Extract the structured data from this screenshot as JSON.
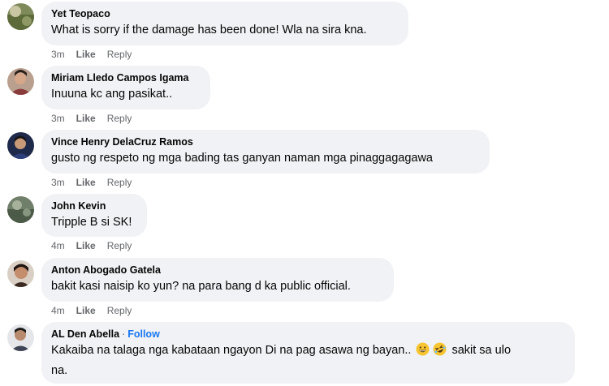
{
  "comments": [
    {
      "author": "Yet Teopaco",
      "text": "What is sorry if the damage has been done! Wla na sira kna.",
      "time": "3m",
      "like": "Like",
      "reply": "Reply"
    },
    {
      "author": "Miriam Lledo Campos Igama",
      "text": "Inuuna kc ang pasikat..",
      "time": "3m",
      "like": "Like",
      "reply": "Reply"
    },
    {
      "author": "Vince Henry DelaCruz Ramos",
      "text": "gusto ng respeto ng mga bading tas ganyan naman mga pinaggagagawa",
      "time": "3m",
      "like": "Like",
      "reply": "Reply"
    },
    {
      "author": "John Kevin",
      "text": "Tripple B si SK!",
      "time": "4m",
      "like": "Like",
      "reply": "Reply"
    },
    {
      "author": "Anton Abogado Gatela",
      "text": "bakit kasi naisip ko yun? na para bang d ka public official.",
      "time": "4m",
      "like": "Like",
      "reply": "Reply"
    },
    {
      "author": "AL Den Abella",
      "separator": "·",
      "follow": "Follow",
      "text_line1": "Kakaiba na talaga nga kabataan ngayon Di na pag asawa ng bayan..",
      "emoji1": "grinning-face-icon",
      "emoji2": "rolling-on-floor-laughing-icon",
      "text_line1_end": "sakit sa ulo",
      "text_line2": "na."
    }
  ],
  "colors": {
    "bubble": "#f0f2f5",
    "meta": "#65676b",
    "link": "#1877f2"
  }
}
